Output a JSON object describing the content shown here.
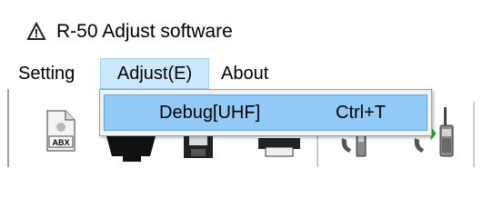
{
  "window": {
    "title": "R-50 Adjust software",
    "icon": "warning-triangle-icon"
  },
  "menu_bar": {
    "items": [
      {
        "label": "Setting"
      },
      {
        "label": "Adjust(E)"
      },
      {
        "label": "About"
      }
    ]
  },
  "dropdown": {
    "items": [
      {
        "label": "Debug[UHF]",
        "shortcut": "Ctrl+T"
      }
    ]
  },
  "toolbar": {
    "buttons": [
      {
        "icon": "abx-file-icon",
        "label": "ABX"
      },
      {
        "icon": "read-radio-icon"
      },
      {
        "icon": "save-disk-icon"
      },
      {
        "icon": "printer-icon"
      },
      {
        "icon": "radio-write-icon"
      },
      {
        "icon": "radio-read-icon"
      }
    ]
  },
  "colors": {
    "menu_highlight": "#cce8ff",
    "dropdown_highlight": "#91c9f7",
    "arrow_red": "#e01010",
    "arrow_green": "#18c018"
  }
}
